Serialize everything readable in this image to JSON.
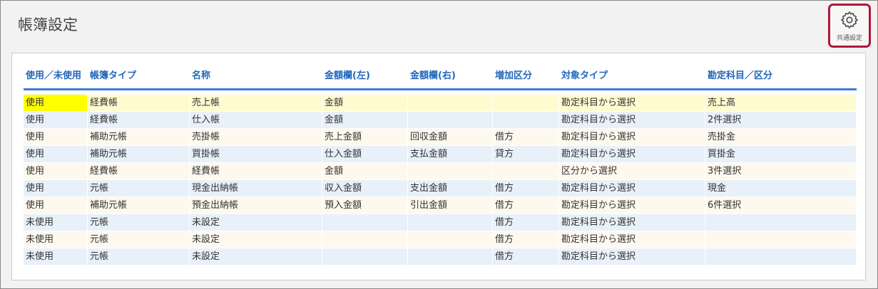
{
  "page_title": "帳簿設定",
  "settings_button": {
    "label": "共通設定",
    "icon": "gear-icon"
  },
  "colors": {
    "header_text": "#2266bb",
    "header_line": "#3a7fd1",
    "highlight": "#ffff00",
    "settings_border": "#b0163c"
  },
  "columns": [
    "使用／未使用",
    "帳簿タイプ",
    "名称",
    "金額欄(左)",
    "金額欄(右)",
    "増加区分",
    "対象タイプ",
    "勘定科目／区分"
  ],
  "rows": [
    [
      "使用",
      "経費帳",
      "売上帳",
      "金額",
      "",
      "",
      "勘定科目から選択",
      "売上高"
    ],
    [
      "使用",
      "経費帳",
      "仕入帳",
      "金額",
      "",
      "",
      "勘定科目から選択",
      "2件選択"
    ],
    [
      "使用",
      "補助元帳",
      "売掛帳",
      "売上金額",
      "回収金額",
      "借方",
      "勘定科目から選択",
      "売掛金"
    ],
    [
      "使用",
      "補助元帳",
      "買掛帳",
      "仕入金額",
      "支払金額",
      "貸方",
      "勘定科目から選択",
      "買掛金"
    ],
    [
      "使用",
      "経費帳",
      "経費帳",
      "金額",
      "",
      "",
      "区分から選択",
      "3件選択"
    ],
    [
      "使用",
      "元帳",
      "現金出納帳",
      "収入金額",
      "支出金額",
      "借方",
      "勘定科目から選択",
      "現金"
    ],
    [
      "使用",
      "補助元帳",
      "預金出納帳",
      "預入金額",
      "引出金額",
      "借方",
      "勘定科目から選択",
      "6件選択"
    ],
    [
      "未使用",
      "元帳",
      "未設定",
      "",
      "",
      "借方",
      "勘定科目から選択",
      ""
    ],
    [
      "未使用",
      "元帳",
      "未設定",
      "",
      "",
      "借方",
      "勘定科目から選択",
      ""
    ],
    [
      "未使用",
      "元帳",
      "未設定",
      "",
      "",
      "借方",
      "勘定科目から選択",
      ""
    ]
  ]
}
